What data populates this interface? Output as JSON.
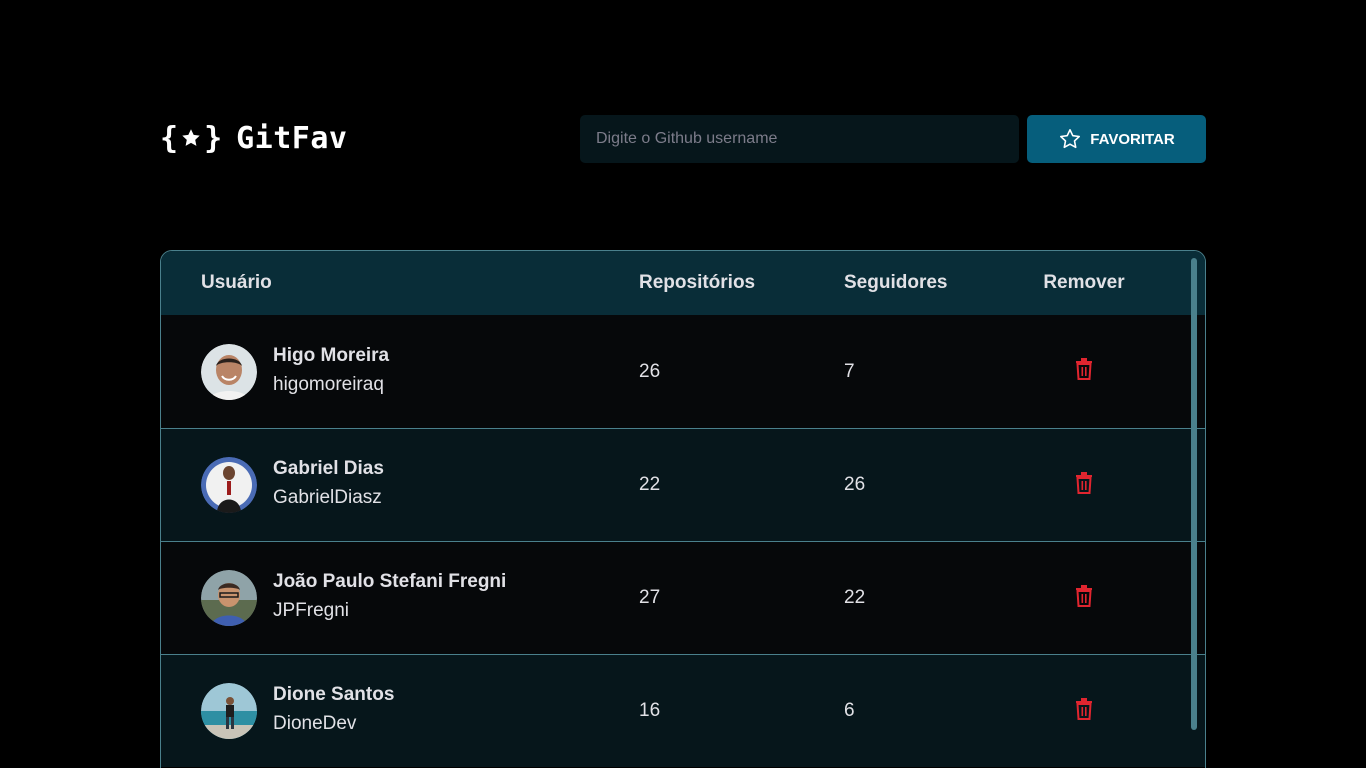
{
  "app": {
    "title": "GitFav",
    "logo_glyph_left": "{",
    "logo_glyph_right": "}"
  },
  "search": {
    "placeholder": "Digite o Github username",
    "value": ""
  },
  "favorite_button": {
    "label": "FAVORITAR",
    "icon": "star-icon"
  },
  "table": {
    "headers": {
      "user": "Usuário",
      "repos": "Repositórios",
      "followers": "Seguidores",
      "remove": "Remover"
    },
    "rows": [
      {
        "name": "Higo Moreira",
        "login": "higomoreiraq",
        "repos": "26",
        "followers": "7"
      },
      {
        "name": "Gabriel Dias",
        "login": "GabrielDiasz",
        "repos": "22",
        "followers": "26"
      },
      {
        "name": "João Paulo Stefani Fregni",
        "login": "JPFregni",
        "repos": "27",
        "followers": "22"
      },
      {
        "name": "Dione Santos",
        "login": "DioneDev",
        "repos": "16",
        "followers": "6"
      }
    ]
  },
  "colors": {
    "background": "#000000",
    "header_row": "#092D38",
    "row_odd": "#06080A",
    "row_even": "#06161B",
    "border": "#4A808C",
    "button": "#065E7C",
    "trash": "#F75A68"
  }
}
